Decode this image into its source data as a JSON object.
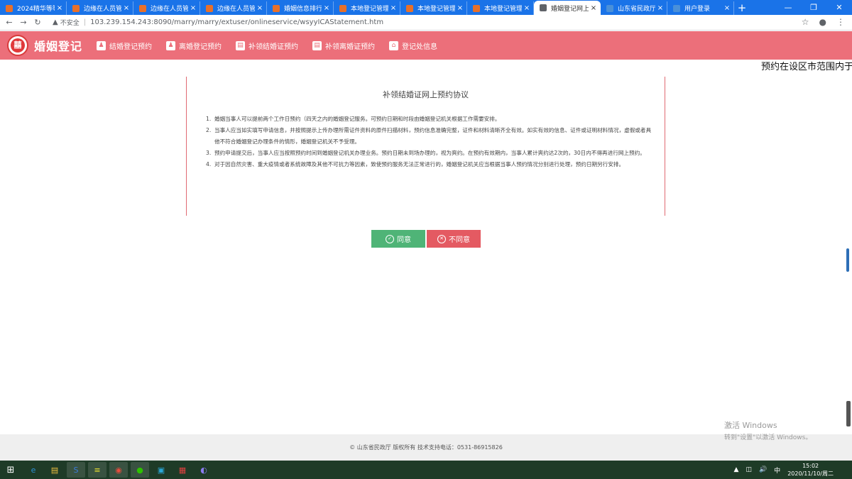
{
  "browser": {
    "tabs": [
      {
        "title": "2024精华等等码",
        "favicon_color": "#e8702a",
        "active": false
      },
      {
        "title": "边缘在人员管理",
        "favicon_color": "#e8702a",
        "active": false
      },
      {
        "title": "边缘在人员管理",
        "favicon_color": "#e8702a",
        "active": false
      },
      {
        "title": "边缘在人员管理",
        "favicon_color": "#e8702a",
        "active": false
      },
      {
        "title": "婚姻信息排行",
        "favicon_color": "#e8702a",
        "active": false
      },
      {
        "title": "本地登记管理",
        "favicon_color": "#e8702a",
        "active": false
      },
      {
        "title": "本地登记管理",
        "favicon_color": "#e8702a",
        "active": false
      },
      {
        "title": "本地登记管理",
        "favicon_color": "#e8702a",
        "active": false
      },
      {
        "title": "婚姻登记网上预约",
        "favicon_color": "#5f6368",
        "active": true
      },
      {
        "title": "山东省民政厅",
        "favicon_color": "#4a90d9",
        "active": false
      },
      {
        "title": "用户登录",
        "favicon_color": "#4a90d9",
        "active": false
      }
    ],
    "tab_close_glyph": "×",
    "new_tab_glyph": "+",
    "window_controls": [
      "—",
      "❐",
      "✕"
    ],
    "insecure_label": "不安全",
    "url": "103.239.154.243:8090/marry/marry/extuser/onlineservice/wsyyICAStatement.htm"
  },
  "site": {
    "name": "婚姻登记",
    "logo_glyph": "囍",
    "nav": [
      {
        "label": "结婚登记预约",
        "icon": "person-icon"
      },
      {
        "label": "离婚登记预约",
        "icon": "person-icon"
      },
      {
        "label": "补领结婚证预约",
        "icon": "certificate-icon"
      },
      {
        "label": "补领离婚证预约",
        "icon": "certificate-icon"
      },
      {
        "label": "登记处信息",
        "icon": "home-icon"
      }
    ],
    "marquee": "预约在设区市范围内于"
  },
  "agreement": {
    "title": "补领结婚证网上预约协议",
    "items": [
      {
        "num": "1.",
        "text": "婚姻当事人可以提前两个工作日预约（四天之内的婚姻登记服务。可预约日期和时段由婚姻登记机关根据工作需要安排。"
      },
      {
        "num": "2.",
        "text": "当事人应当如实填写申请信息，并按照提示上传办理所需证件资料的原件扫描材料，预约信息准确完整，证件和材料清晰齐全有效。如实有效的信息、证件或证明材料情况，虚假或者具他不符合婚姻登记办理条件的情形，婚姻登记机关不予受理。"
      },
      {
        "num": "3.",
        "text": "预约申请提交后，当事人应当按照预约时间到婚姻登记机关办理业务。预约日期未到场办理的，视为爽约。在预约有效期内，当事人累计爽约达2次的，30日内不得再进行网上预约。"
      },
      {
        "num": "4.",
        "text": "对于因自然灾害、重大疫情或者系统故障及其他不可抗力等因素，致使预约服务无法正常进行的，婚姻登记机关应当根据当事人预约情况分别进行处理，预约日期另行安排。"
      }
    ],
    "agree_label": "同意",
    "disagree_label": "不同意"
  },
  "footer": {
    "text": "© 山东省民政厅 版权所有    技术支持电话：0531-86915826"
  },
  "watermark": {
    "line1": "激活 Windows",
    "line2": "转到\"设置\"以激活 Windows。"
  },
  "taskbar": {
    "start_glyph": "⊞",
    "apps": [
      {
        "name": "ie-icon",
        "glyph": "e",
        "color": "#2b8fd6",
        "running": false
      },
      {
        "name": "explorer-icon",
        "glyph": "▤",
        "color": "#f0c040",
        "running": false
      },
      {
        "name": "speedtest-icon",
        "glyph": "S",
        "color": "#3b7dd8",
        "running": true
      },
      {
        "name": "notes-icon",
        "glyph": "≡",
        "color": "#e8e030",
        "running": true
      },
      {
        "name": "chrome-icon",
        "glyph": "◉",
        "color": "#e84c3d",
        "running": true
      },
      {
        "name": "wechat-icon",
        "glyph": "●",
        "color": "#2dc100",
        "running": true
      },
      {
        "name": "store-icon",
        "glyph": "▣",
        "color": "#2aa7d8",
        "running": false
      },
      {
        "name": "app-icon",
        "glyph": "▦",
        "color": "#e04040",
        "running": false
      },
      {
        "name": "browser-icon",
        "glyph": "◐",
        "color": "#8a7cf0",
        "running": false
      }
    ],
    "tray_icons": [
      "▲",
      "◫",
      "🔊",
      "中"
    ],
    "time": "15:02",
    "date": "2020/11/10/周二"
  }
}
